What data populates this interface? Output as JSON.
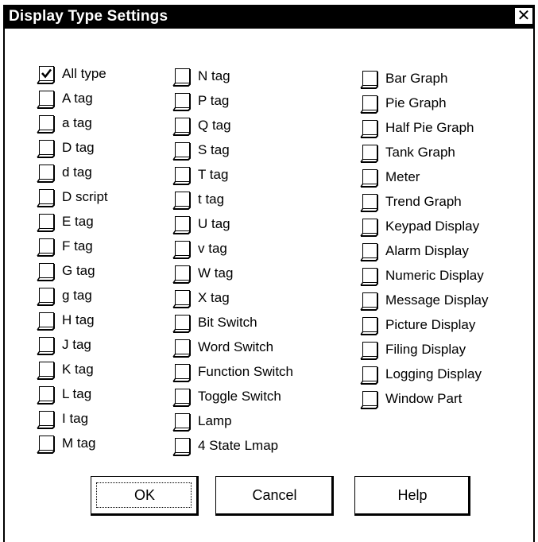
{
  "dialog": {
    "title": "Display Type Settings",
    "close_glyph": "✕"
  },
  "columns": [
    {
      "items": [
        {
          "label": "All type",
          "checked": true
        },
        {
          "label": "A tag",
          "checked": false
        },
        {
          "label": "a tag",
          "checked": false
        },
        {
          "label": "D tag",
          "checked": false
        },
        {
          "label": "d tag",
          "checked": false
        },
        {
          "label": "D script",
          "checked": false
        },
        {
          "label": "E tag",
          "checked": false
        },
        {
          "label": "F tag",
          "checked": false
        },
        {
          "label": "G tag",
          "checked": false
        },
        {
          "label": "g tag",
          "checked": false
        },
        {
          "label": "H tag",
          "checked": false
        },
        {
          "label": "J tag",
          "checked": false
        },
        {
          "label": "K tag",
          "checked": false
        },
        {
          "label": "L tag",
          "checked": false
        },
        {
          "label": "I tag",
          "checked": false
        },
        {
          "label": "M tag",
          "checked": false
        }
      ]
    },
    {
      "items": [
        {
          "label": "N tag",
          "checked": false
        },
        {
          "label": "P tag",
          "checked": false
        },
        {
          "label": "Q tag",
          "checked": false
        },
        {
          "label": "S tag",
          "checked": false
        },
        {
          "label": "T tag",
          "checked": false
        },
        {
          "label": "t tag",
          "checked": false
        },
        {
          "label": "U tag",
          "checked": false
        },
        {
          "label": "v tag",
          "checked": false
        },
        {
          "label": "W tag",
          "checked": false
        },
        {
          "label": "X tag",
          "checked": false
        },
        {
          "label": "Bit Switch",
          "checked": false
        },
        {
          "label": "Word Switch",
          "checked": false
        },
        {
          "label": "Function Switch",
          "checked": false
        },
        {
          "label": "Toggle Switch",
          "checked": false
        },
        {
          "label": "Lamp",
          "checked": false
        },
        {
          "label": "4 State Lmap",
          "checked": false
        }
      ]
    },
    {
      "items": [
        {
          "label": "Bar Graph",
          "checked": false
        },
        {
          "label": "Pie Graph",
          "checked": false
        },
        {
          "label": "Half Pie Graph",
          "checked": false
        },
        {
          "label": "Tank Graph",
          "checked": false
        },
        {
          "label": "Meter",
          "checked": false
        },
        {
          "label": "Trend Graph",
          "checked": false
        },
        {
          "label": "Keypad Display",
          "checked": false
        },
        {
          "label": "Alarm Display",
          "checked": false
        },
        {
          "label": "Numeric Display",
          "checked": false
        },
        {
          "label": "Message Display",
          "checked": false
        },
        {
          "label": "Picture Display",
          "checked": false
        },
        {
          "label": "Filing Display",
          "checked": false
        },
        {
          "label": "Logging Display",
          "checked": false
        },
        {
          "label": "Window Part",
          "checked": false
        }
      ]
    }
  ],
  "buttons": {
    "ok": "OK",
    "cancel": "Cancel",
    "help": "Help"
  }
}
